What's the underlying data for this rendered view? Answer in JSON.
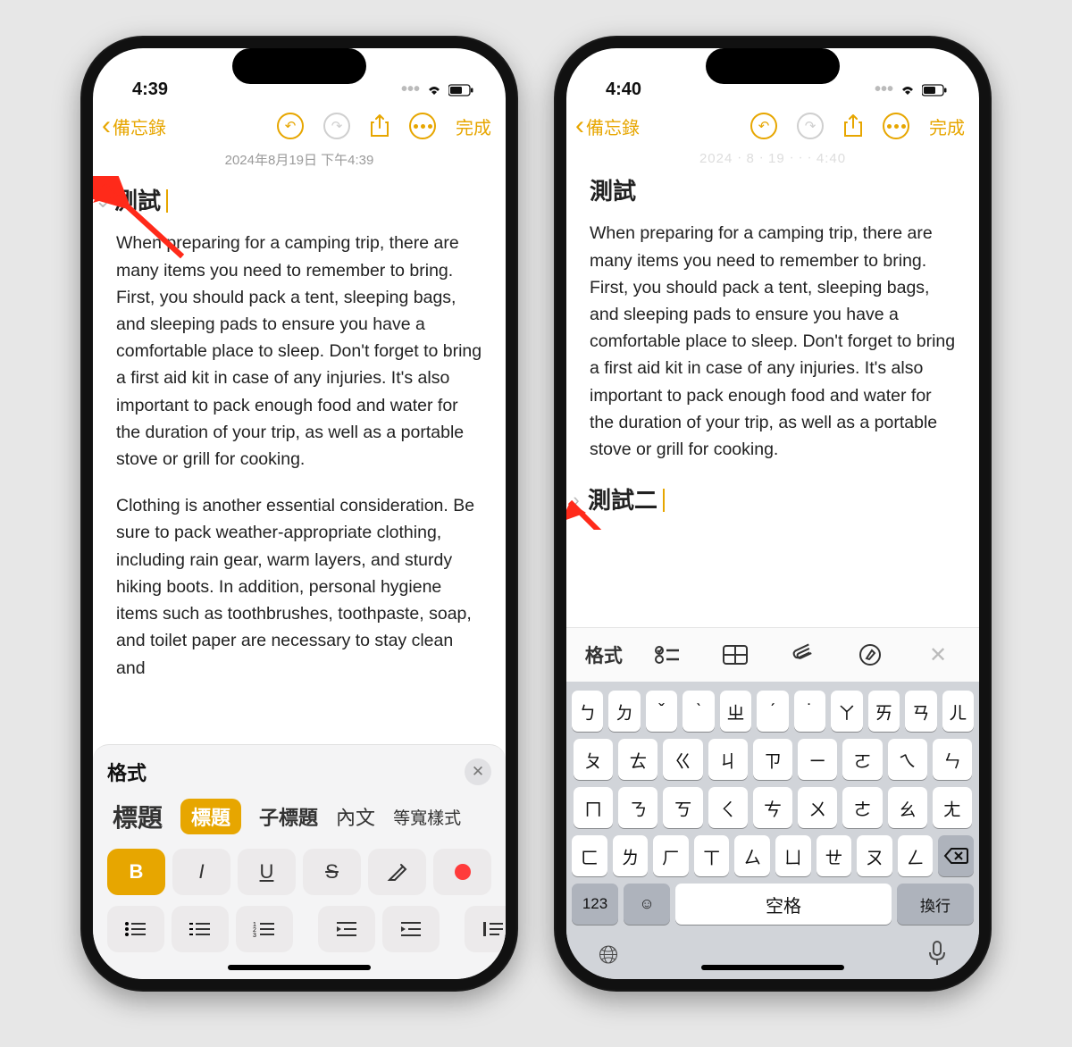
{
  "accent": "#e7a600",
  "phoneA": {
    "time": "4:39",
    "back_label": "備忘錄",
    "done_label": "完成",
    "timestamp": "2024年8月19日 下午4:39",
    "title": "測試",
    "para1": "When preparing for a camping trip, there are many items you need to remember to bring. First, you should pack a tent, sleeping bags, and sleeping pads to ensure you have a comfortable place to sleep. Don't forget to bring a first aid kit in case of any injuries. It's also important to pack enough food and water for the duration of your trip, as well as a portable stove or grill for cooking.",
    "para2": "Clothing is another essential consideration. Be sure to pack weather-appropriate clothing, including rain gear, warm layers, and sturdy hiking boots. In addition, personal hygiene items such as toothbrushes, toothpaste, soap, and toilet paper are necessary to stay clean and",
    "format": {
      "panel_title": "格式",
      "styles": [
        "標題",
        "標題",
        "子標題",
        "內文",
        "等寬樣式"
      ],
      "active_style_index": 1,
      "bius": [
        "B",
        "I",
        "U",
        "S"
      ],
      "active_bius_index": 0
    }
  },
  "phoneB": {
    "time": "4:40",
    "back_label": "備忘錄",
    "done_label": "完成",
    "timestamp_faded": "2024年8月19日 下午4:40",
    "title": "測試",
    "para1": "When preparing for a camping trip, there are many items you need to remember to bring. First, you should pack a tent, sleeping bags, and sleeping pads to ensure you have a comfortable place to sleep. Don't forget to bring a first aid kit in case of any injuries. It's also important to pack enough food and water for the duration of your trip, as well as a portable stove or grill for cooking.",
    "title2": "測試二",
    "kb_toolbar_label": "格式",
    "keyboard_rows": [
      [
        "ㄅ",
        "ㄉ",
        "ˇ",
        "ˋ",
        "ㄓ",
        "ˊ",
        "˙",
        "ㄚ",
        "ㄞ",
        "ㄢ",
        "ㄦ"
      ],
      [
        "ㄆ",
        "ㄊ",
        "ㄍ",
        "ㄐ",
        "ㄗ",
        "ㄧ",
        "ㄛ",
        "ㄟ",
        "ㄣ"
      ],
      [
        "ㄇ",
        "ㄋ",
        "ㄎ",
        "ㄑ",
        "ㄘ",
        "ㄨ",
        "ㄜ",
        "ㄠ",
        "ㄤ"
      ],
      [
        "ㄈ",
        "ㄌ",
        "ㄏ",
        "ㄒ",
        "ㄙ",
        "ㄩ",
        "ㄝ",
        "ㄡ",
        "ㄥ"
      ]
    ],
    "key_123": "123",
    "key_space": "空格",
    "key_enter": "換行"
  }
}
